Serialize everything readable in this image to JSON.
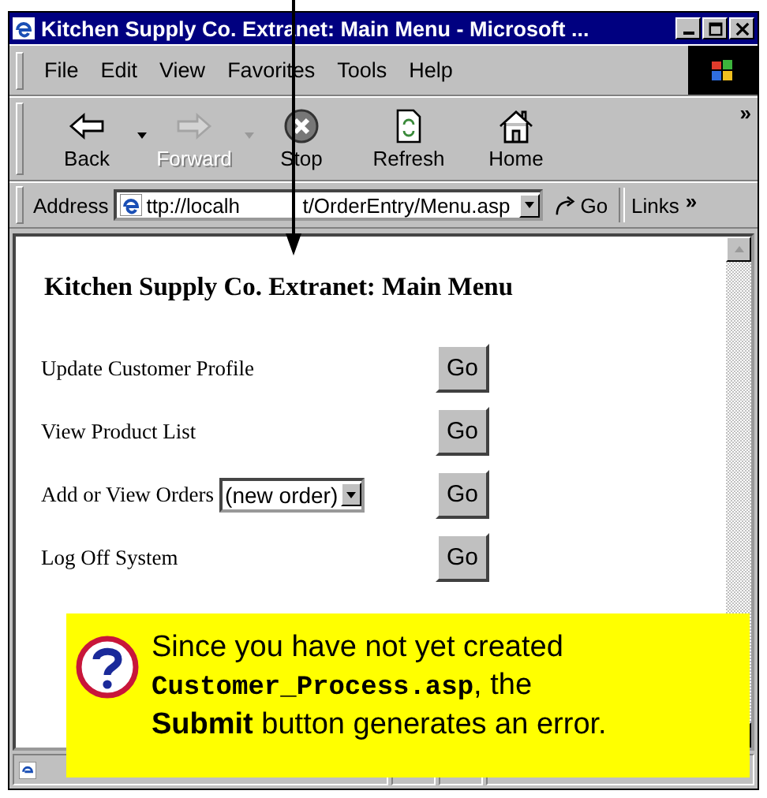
{
  "window": {
    "title": "Kitchen Supply Co. Extranet: Main Menu - Microsoft ..."
  },
  "menu": [
    {
      "label": "File"
    },
    {
      "label": "Edit"
    },
    {
      "label": "View"
    },
    {
      "label": "Favorites"
    },
    {
      "label": "Tools"
    },
    {
      "label": "Help"
    }
  ],
  "toolbar": {
    "buttons": [
      {
        "label": "Back",
        "kind": "back",
        "disabled": false,
        "dropdown": true
      },
      {
        "label": "Forward",
        "kind": "forward",
        "disabled": true,
        "dropdown": true
      },
      {
        "label": "Stop",
        "kind": "stop",
        "disabled": false,
        "dropdown": false
      },
      {
        "label": "Refresh",
        "kind": "refresh",
        "disabled": false,
        "dropdown": false
      },
      {
        "label": "Home",
        "kind": "home",
        "disabled": false,
        "dropdown": false
      }
    ],
    "more": "»"
  },
  "address_bar": {
    "label": "Address",
    "value_parts": [
      "ttp://localh",
      "t/OrderEntry/Menu.asp"
    ],
    "go": "Go",
    "links": "Links",
    "more": "»"
  },
  "page": {
    "heading": "Kitchen Supply Co. Extranet: Main Menu",
    "rows": [
      {
        "label": "Update Customer Profile",
        "kind": "plain",
        "button": "Go"
      },
      {
        "label": "View Product List",
        "kind": "plain",
        "button": "Go"
      },
      {
        "label": "Add or View Orders",
        "kind": "select",
        "select_value": "(new order)",
        "button": "Go"
      },
      {
        "label": "Log Off System",
        "kind": "plain",
        "button": "Go"
      }
    ]
  },
  "callout": {
    "segments": [
      {
        "kind": "plain",
        "text": "Since you have not yet created "
      },
      {
        "kind": "code",
        "text": "Customer_Process.asp"
      },
      {
        "kind": "plain",
        "text": ", the "
      },
      {
        "kind": "bold",
        "text": "Submit"
      },
      {
        "kind": "plain",
        "text": " button generates an error."
      }
    ]
  }
}
